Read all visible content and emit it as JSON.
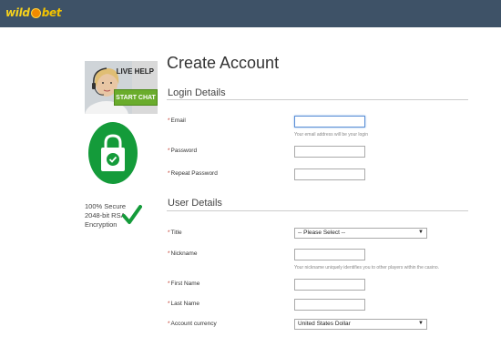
{
  "header": {
    "logo": {
      "part1": "wild",
      "part2": "bet"
    }
  },
  "sidebar": {
    "live_help": {
      "title": "LIVE HELP",
      "button_label": "START CHAT"
    },
    "secure_text": [
      "100% Secure",
      "2048-bit RSA",
      "Encryption"
    ],
    "colors": {
      "green": "#149b3a",
      "chat_green": "#6aac2c"
    }
  },
  "form": {
    "title": "Create Account",
    "login_section": {
      "title": "Login Details",
      "email_label": "Email",
      "email_hint": "Your email address will be your login",
      "password_label": "Password",
      "repeat_password_label": "Repeat Password"
    },
    "user_section": {
      "title": "User Details",
      "title_label": "Title",
      "title_select_value": "-- Please Select --",
      "nickname_label": "Nickname",
      "nickname_hint": "Your nickname uniquely identifies you to other players within the casino.",
      "first_name_label": "First Name",
      "last_name_label": "Last Name",
      "currency_label": "Account currency",
      "currency_select_value": "United States Dollar"
    },
    "required_marker": "*"
  }
}
